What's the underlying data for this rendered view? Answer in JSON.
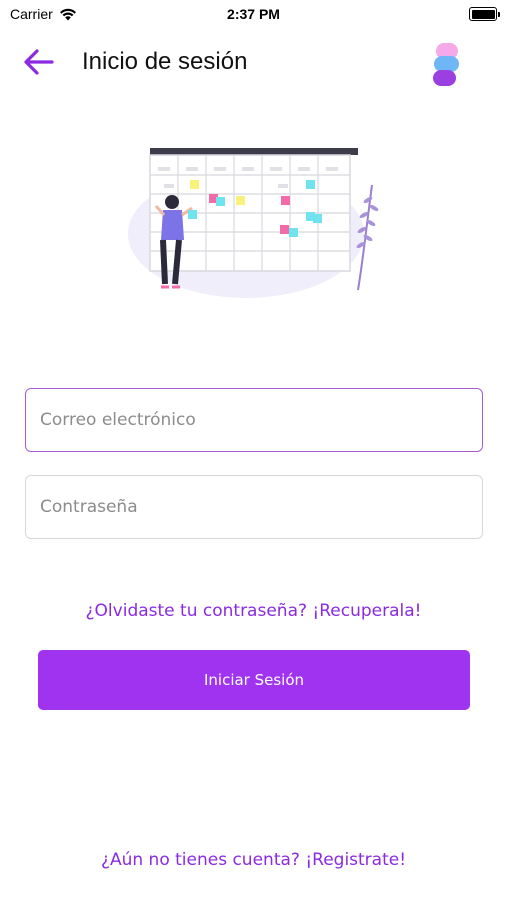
{
  "status_bar": {
    "carrier": "Carrier",
    "time": "2:37 PM"
  },
  "header": {
    "title": "Inicio de sesión"
  },
  "icons": {
    "back": "arrow-left-icon",
    "wifi": "wifi-icon",
    "battery": "battery-icon",
    "logo": "app-logo"
  },
  "form": {
    "email": {
      "placeholder": "Correo electrónico",
      "value": ""
    },
    "password": {
      "placeholder": "Contraseña",
      "value": ""
    }
  },
  "links": {
    "forgot": "¿Olvidaste tu contraseña? ¡Recuperala!",
    "register": "¿Aún no tienes cuenta? ¡Registrate!"
  },
  "buttons": {
    "login": "Iniciar Sesión"
  },
  "colors": {
    "accent": "#a033f0",
    "link": "#8a2be2",
    "active_border": "#a45bd8"
  }
}
